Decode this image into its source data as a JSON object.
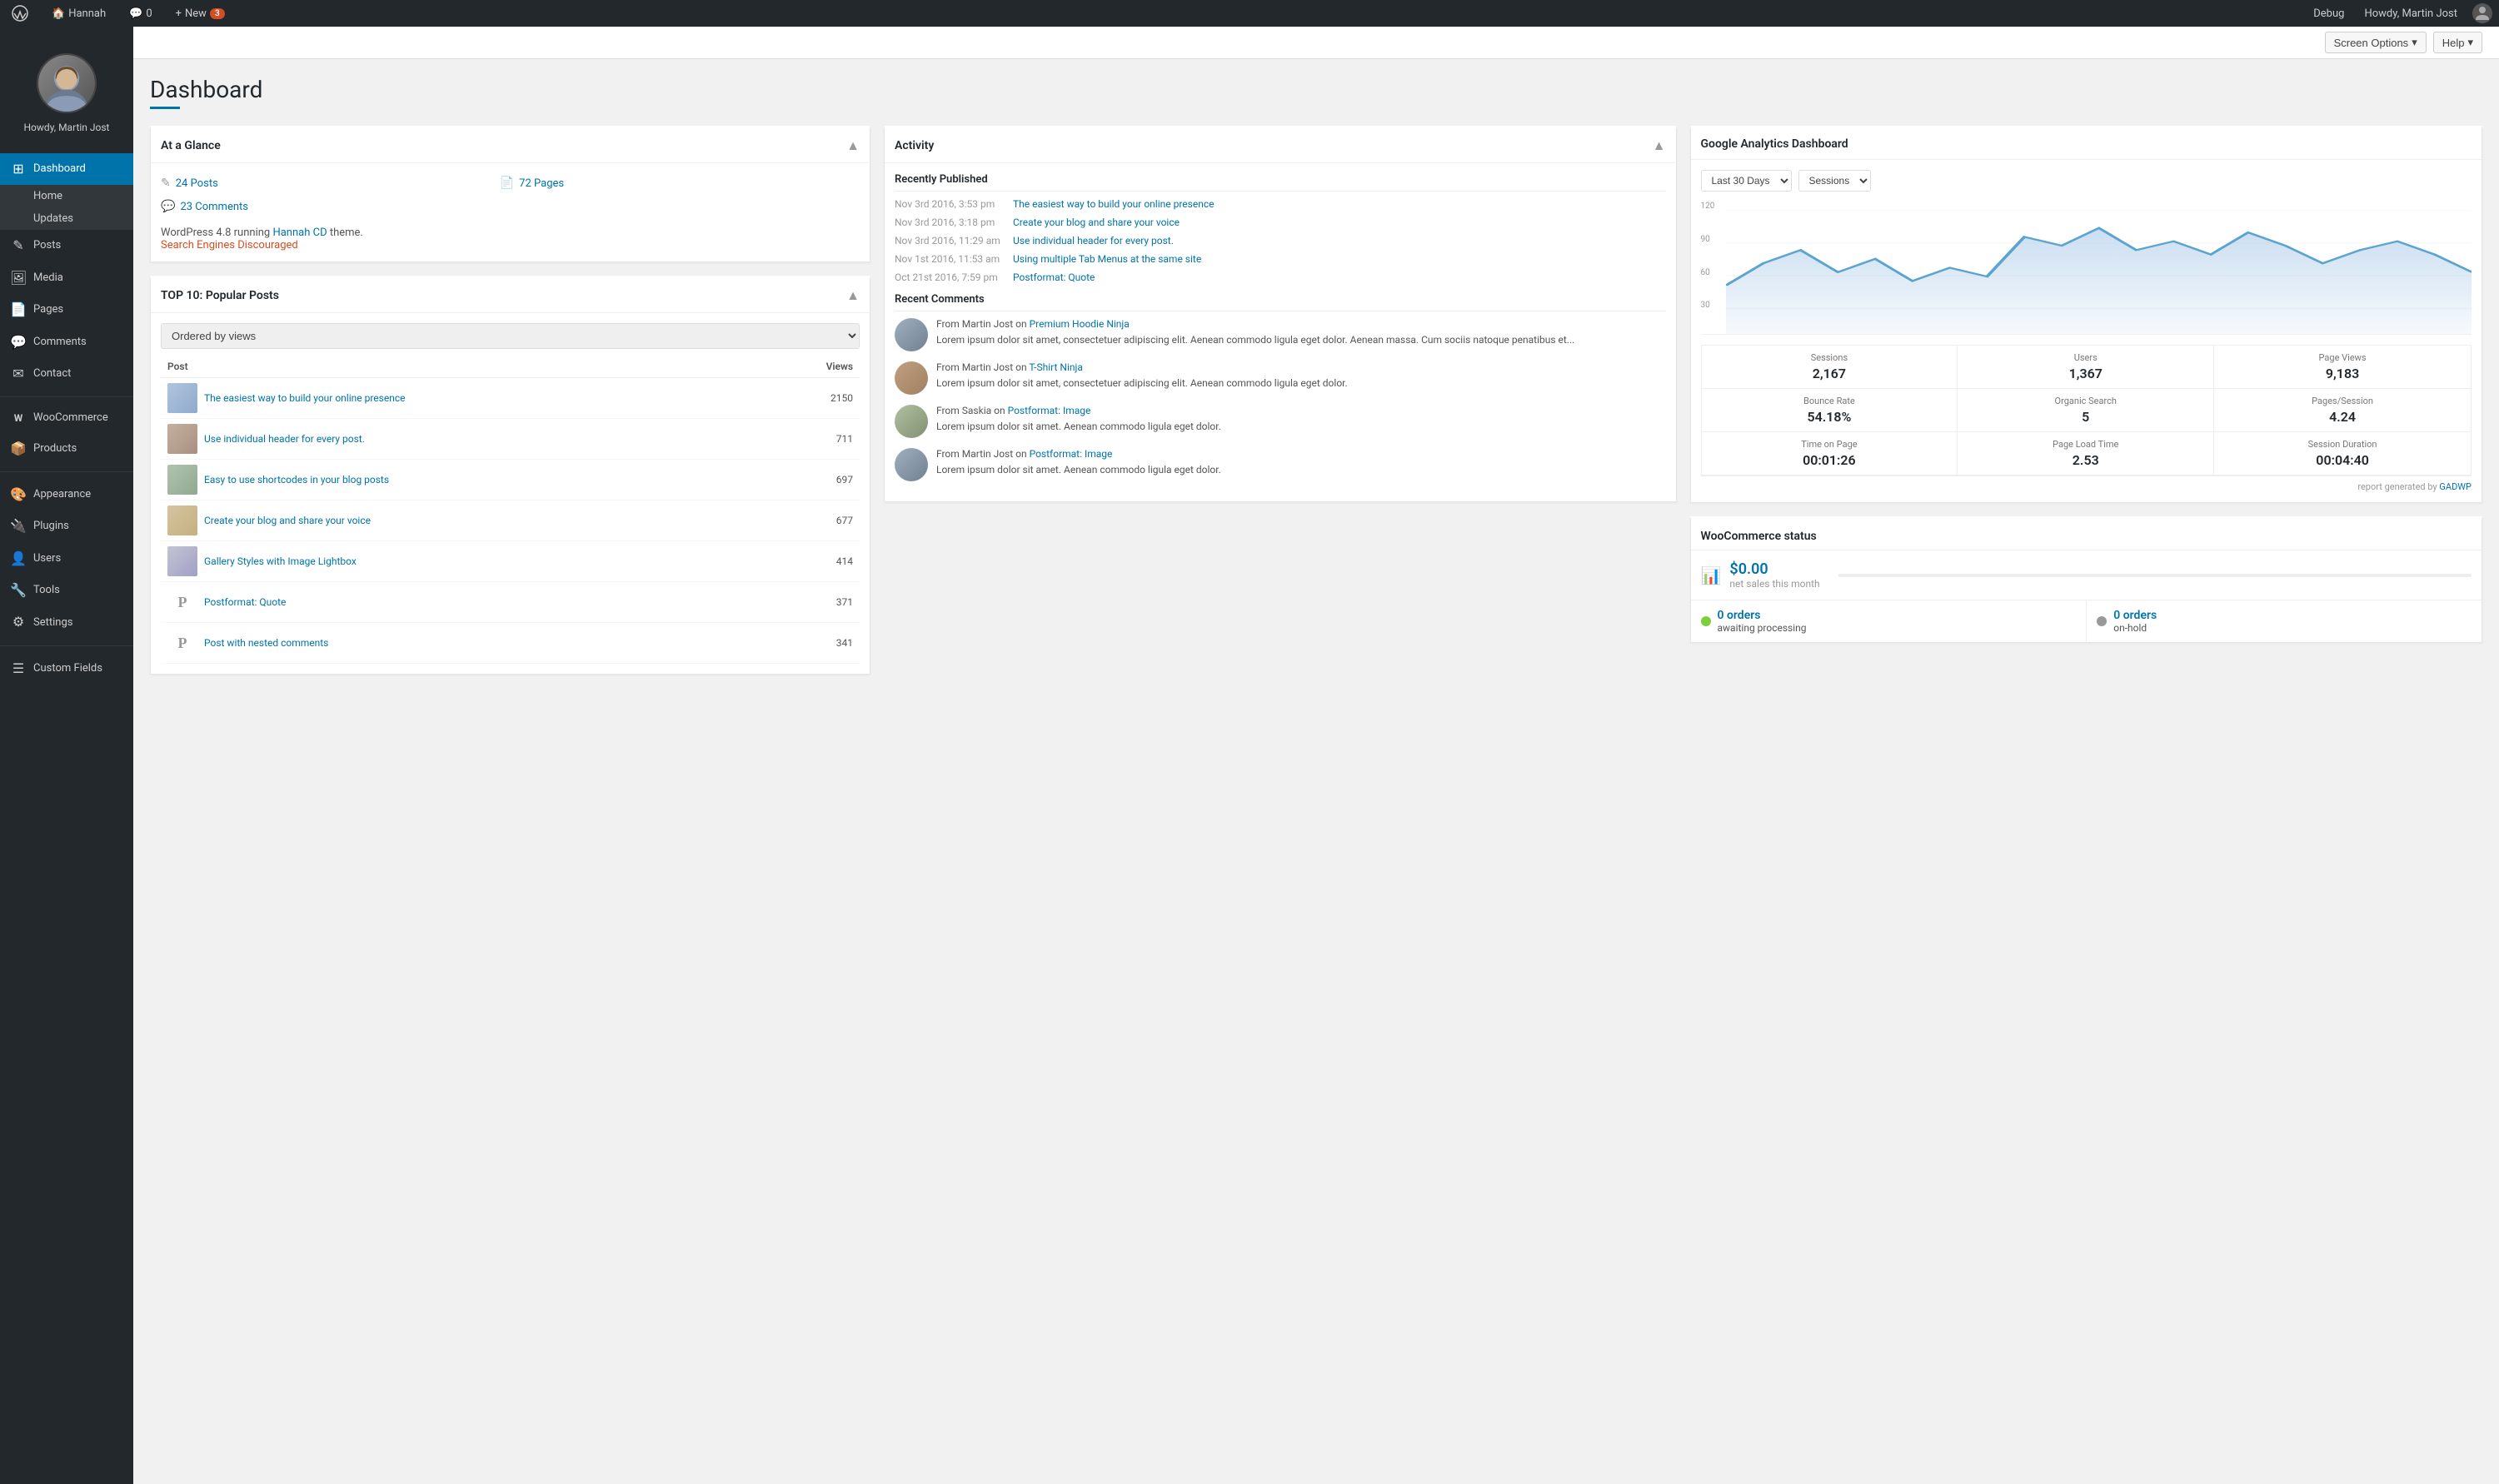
{
  "adminbar": {
    "site_name": "Hannah",
    "comments_count": "0",
    "new_label": "New",
    "new_badge": "3",
    "debug_label": "Debug",
    "howdy": "Howdy, Martin Jost"
  },
  "topbar": {
    "screen_options": "Screen Options",
    "help": "Help"
  },
  "sidebar": {
    "username": "Howdy, Martin Jost",
    "items": [
      {
        "id": "dashboard",
        "label": "Dashboard",
        "icon": "⊞",
        "active": true
      },
      {
        "id": "home",
        "label": "Home",
        "sub": true
      },
      {
        "id": "updates",
        "label": "Updates",
        "sub": true
      },
      {
        "id": "posts",
        "label": "Posts",
        "icon": "✎"
      },
      {
        "id": "media",
        "label": "Media",
        "icon": "🖼"
      },
      {
        "id": "pages",
        "label": "Pages",
        "icon": "📄"
      },
      {
        "id": "comments",
        "label": "Comments",
        "icon": "💬"
      },
      {
        "id": "contact",
        "label": "Contact",
        "icon": "✉"
      },
      {
        "id": "woocommerce",
        "label": "WooCommerce",
        "icon": "W"
      },
      {
        "id": "products",
        "label": "Products",
        "icon": "📦"
      },
      {
        "id": "appearance",
        "label": "Appearance",
        "icon": "🎨"
      },
      {
        "id": "plugins",
        "label": "Plugins",
        "icon": "🔌"
      },
      {
        "id": "users",
        "label": "Users",
        "icon": "👤"
      },
      {
        "id": "tools",
        "label": "Tools",
        "icon": "🔧"
      },
      {
        "id": "settings",
        "label": "Settings",
        "icon": "⚙"
      },
      {
        "id": "custom-fields",
        "label": "Custom Fields",
        "icon": "☰"
      }
    ]
  },
  "dashboard": {
    "title": "Dashboard",
    "at_a_glance": {
      "title": "At a Glance",
      "posts_count": "24 Posts",
      "pages_count": "72 Pages",
      "comments_count": "23 Comments",
      "wp_info": "WordPress 4.8 running ",
      "theme_link": "Hannah CD",
      "theme_suffix": " theme.",
      "warning": "Search Engines Discouraged"
    },
    "popular_posts": {
      "title": "TOP 10: Popular Posts",
      "filter_label": "Ordered by views",
      "col_post": "Post",
      "col_views": "Views",
      "posts": [
        {
          "title": "The easiest way to build your online presence",
          "views": "2150",
          "has_thumb": true,
          "thumb_class": "thumb-1"
        },
        {
          "title": "Use individual header for every post.",
          "views": "711",
          "has_thumb": true,
          "thumb_class": "thumb-2"
        },
        {
          "title": "Easy to use shortcodes in your blog posts",
          "views": "697",
          "has_thumb": true,
          "thumb_class": "thumb-3"
        },
        {
          "title": "Create your blog and share your voice",
          "views": "677",
          "has_thumb": true,
          "thumb_class": "thumb-4"
        },
        {
          "title": "Gallery Styles with Image Lightbox",
          "views": "414",
          "has_thumb": true,
          "thumb_class": "thumb-5"
        },
        {
          "title": "Postformat: Quote",
          "views": "371",
          "has_thumb": false,
          "placeholder": "P"
        },
        {
          "title": "Post with nested comments",
          "views": "341",
          "has_thumb": false,
          "placeholder": "P"
        }
      ]
    },
    "activity": {
      "title": "Activity",
      "recently_published_title": "Recently Published",
      "items": [
        {
          "date": "Nov 3rd 2016, 3:53 pm",
          "link": "The easiest way to build your online presence"
        },
        {
          "date": "Nov 3rd 2016, 3:18 pm",
          "link": "Create your blog and share your voice"
        },
        {
          "date": "Nov 3rd 2016, 11:29 am",
          "link": "Use individual header for every post."
        },
        {
          "date": "Nov 1st 2016, 11:53 am",
          "link": "Using multiple Tab Menus at the same site"
        },
        {
          "date": "Oct 21st 2016, 7:59 pm",
          "link": "Postformat: Quote"
        }
      ],
      "recent_comments_title": "Recent Comments",
      "comments": [
        {
          "from": "From Martin Jost on",
          "post_link": "Premium Hoodie Ninja",
          "text": "Lorem ipsum dolor sit amet, consectetuer adipiscing elit. Aenean commodo ligula eget dolor. Aenean massa. Cum sociis natoque penatibus et...",
          "avatar_class": "avatar-1"
        },
        {
          "from": "From Martin Jost on",
          "post_link": "T-Shirt Ninja",
          "text": "Lorem ipsum dolor sit amet, consectetuer adipiscing elit. Aenean commodo ligula eget dolor.",
          "avatar_class": "avatar-2"
        },
        {
          "from": "From Saskia on",
          "post_link": "Postformat: Image",
          "text": "Lorem ipsum dolor sit amet. Aenean commodo ligula eget dolor.",
          "avatar_class": "avatar-3"
        },
        {
          "from": "From Martin Jost on",
          "post_link": "Postformat: Image",
          "text": "Lorem ipsum dolor sit amet. Aenean commodo ligula eget dolor.",
          "avatar_class": "avatar-4"
        }
      ]
    },
    "google_analytics": {
      "title": "Google Analytics Dashboard",
      "period_label": "Last 30 Days",
      "session_label": "Sessions",
      "y_labels": [
        "120",
        "90",
        "60",
        "30"
      ],
      "stats": [
        {
          "label": "Sessions",
          "value": "2,167"
        },
        {
          "label": "Users",
          "value": "1,367"
        },
        {
          "label": "Page Views",
          "value": "9,183"
        },
        {
          "label": "Bounce Rate",
          "value": "54.18%"
        },
        {
          "label": "Organic Search",
          "value": "5"
        },
        {
          "label": "Pages/Session",
          "value": "4.24"
        },
        {
          "label": "Time on Page",
          "value": "00:01:26"
        },
        {
          "label": "Page Load Time",
          "value": "2.53"
        },
        {
          "label": "Session Duration",
          "value": "00:04:40"
        }
      ],
      "report_prefix": "report generated by ",
      "report_link": "GADWP"
    },
    "woocommerce": {
      "title": "WooCommerce status",
      "net_sales": "$0.00",
      "net_sales_label": "net sales this month",
      "orders": [
        {
          "count": "0 orders",
          "label": "awaiting processing",
          "dot_class": "green"
        },
        {
          "count": "0 orders",
          "label": "on-hold",
          "dot_class": "gray"
        }
      ]
    }
  }
}
